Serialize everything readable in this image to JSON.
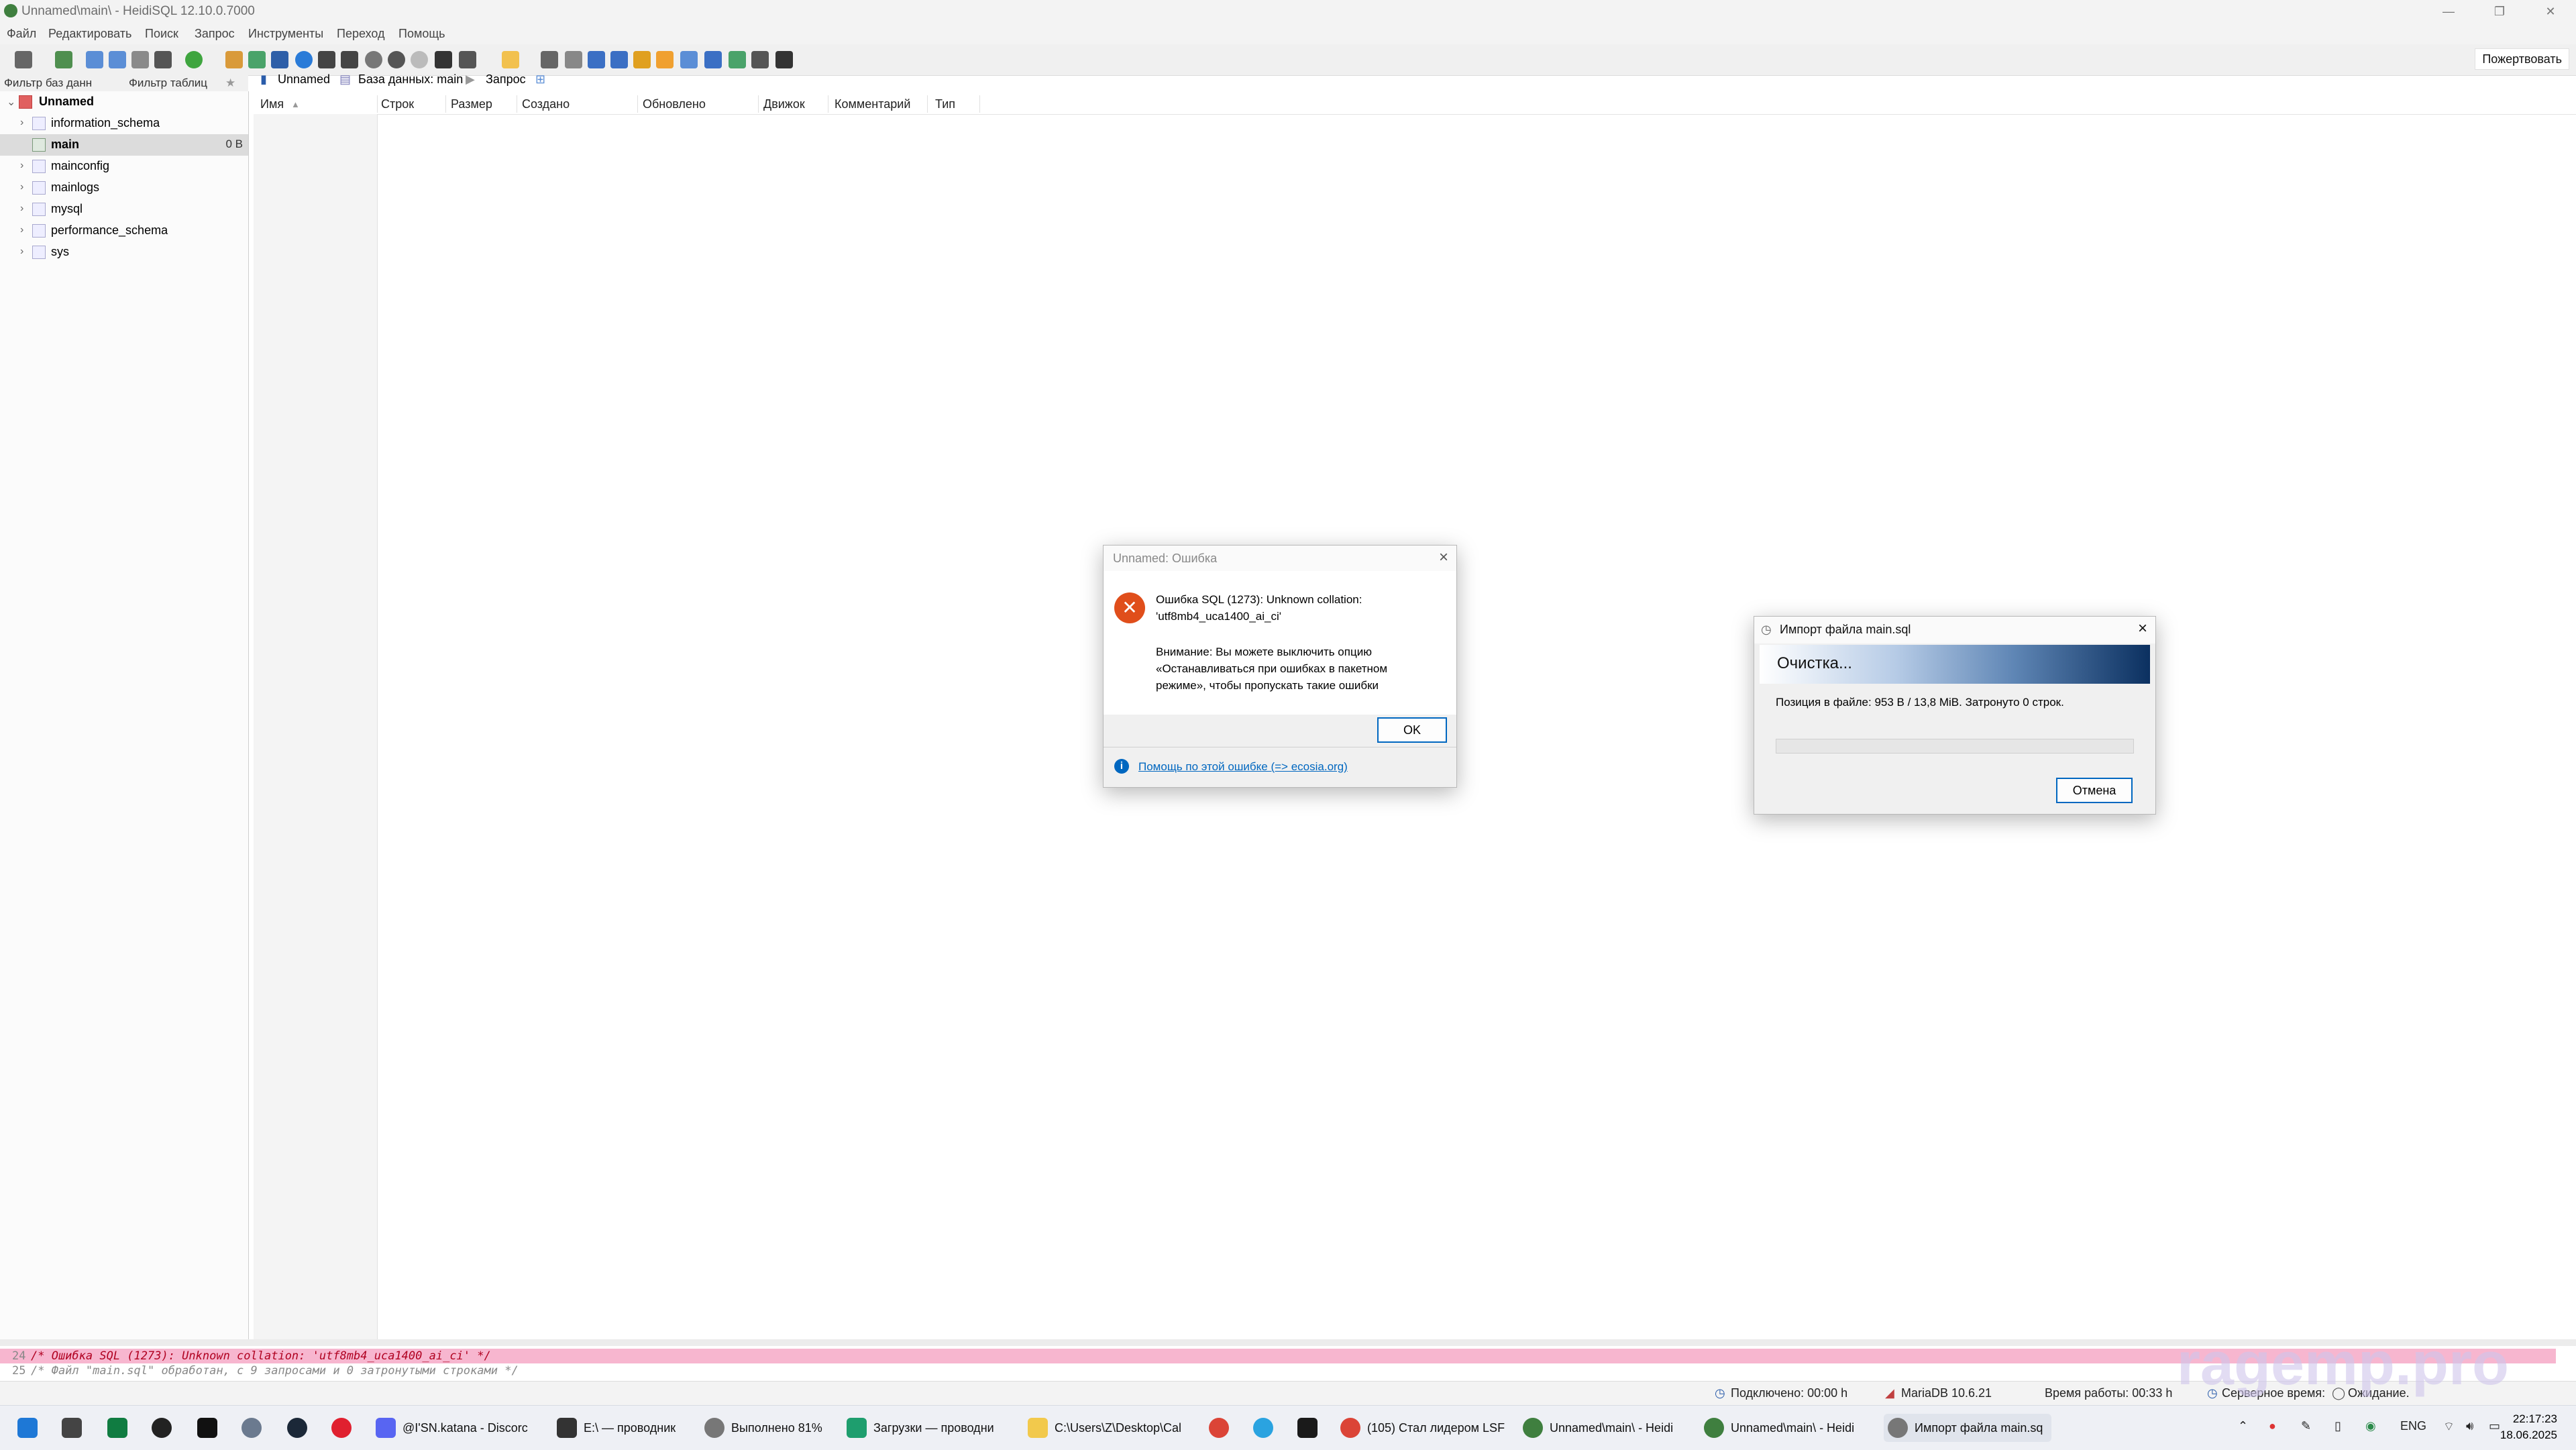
{
  "window": {
    "title": "Unnamed\\main\\ - HeidiSQL 12.10.0.7000"
  },
  "menu": [
    "Файл",
    "Редактировать",
    "Поиск",
    "Запрос",
    "Инструменты",
    "Переход",
    "Помощь"
  ],
  "toolbar": {
    "donate_label": "Пожертвовать"
  },
  "filters": {
    "db_filter": "Фильтр баз данн",
    "table_filter": "Фильтр таблиц"
  },
  "tree": {
    "root": "Unnamed",
    "items": [
      {
        "name": "information_schema",
        "size": ""
      },
      {
        "name": "main",
        "size": "0 B"
      },
      {
        "name": "mainconfig",
        "size": ""
      },
      {
        "name": "mainlogs",
        "size": ""
      },
      {
        "name": "mysql",
        "size": ""
      },
      {
        "name": "performance_schema",
        "size": ""
      },
      {
        "name": "sys",
        "size": ""
      }
    ]
  },
  "tabs": [
    "Unnamed",
    "База данных: main",
    "Запрос"
  ],
  "grid": {
    "columns": [
      "Имя",
      "Строк",
      "Размер",
      "Создано",
      "Обновлено",
      "Движок",
      "Комментарий",
      "Тип"
    ]
  },
  "error_dialog": {
    "title": "Unnamed: Ошибка",
    "message_line1": "Ошибка SQL (1273): Unknown collation:",
    "message_line2": "'utf8mb4_uca1400_ai_ci'",
    "warning_line1": "Внимание: Вы можете выключить опцию",
    "warning_line2": "«Останавливаться при ошибках в пакетном",
    "warning_line3": "режиме», чтобы пропускать такие ошибки",
    "ok_label": "OK",
    "help_link": "Помощь по этой ошибке (=> ecosia.org)"
  },
  "import_dialog": {
    "title": "Импорт файла main.sql",
    "banner": "Очистка...",
    "position_text": "Позиция в файле: 953 B / 13,8 MiB. Затронуто 0 строк.",
    "progress": 0.0,
    "cancel_label": "Отмена"
  },
  "log": [
    {
      "num": "24",
      "text": "/* Ошибка SQL (1273): Unknown collation: 'utf8mb4_uca1400_ai_ci' */",
      "highlight": true
    },
    {
      "num": "25",
      "text": "/* Файл \"main.sql\" обработан, с 9 запросами и 0 затронутыми строками */",
      "highlight": false
    }
  ],
  "status": {
    "connected": "Подключено: 00:00 h",
    "server": "MariaDB 10.6.21",
    "uptime": "Время работы: 00:33 h",
    "server_time": "Серверное время: ",
    "state": "Ожидание."
  },
  "watermark": "ragemp.pro",
  "taskbar": {
    "items": [
      {
        "label": "@I'SN.katana - Discorc",
        "color": "#5865f2"
      },
      {
        "label": "E:\\ — проводник",
        "color": "#333333"
      },
      {
        "label": "Выполнено 81%",
        "color": "#777777"
      },
      {
        "label": "Загрузки — проводни",
        "color": "#1e9e6e"
      },
      {
        "label": "C:\\Users\\Z\\Desktop\\Cal",
        "color": "#f2c94c"
      },
      {
        "label": "(105) Стал лидером LSF",
        "color": "#db4437"
      },
      {
        "label": "Unnamed\\main\\ - Heidi",
        "color": "#3f7f3f"
      },
      {
        "label": "Unnamed\\main\\ - Heidi",
        "color": "#3f7f3f"
      },
      {
        "label": "Импорт файла main.sq",
        "color": "#777777"
      }
    ],
    "lang": "ENG",
    "time": "22:17:23",
    "date": "18.06.2025"
  },
  "colors": {
    "accent": "#0067c0",
    "error": "#e04e1b",
    "log_highlight": "#f7b6cf"
  }
}
